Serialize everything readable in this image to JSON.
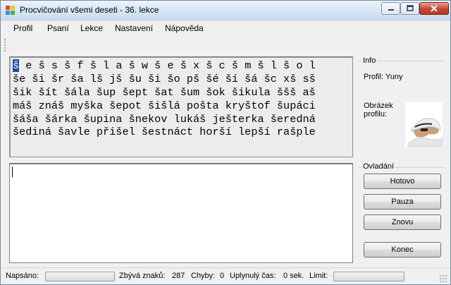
{
  "window": {
    "title": "Procvičování všemi deseti - 36. lekce"
  },
  "menu": {
    "items": [
      "Profil",
      "Psaní",
      "Lekce",
      "Nastavení",
      "Nápověda"
    ]
  },
  "practice": {
    "current_char": "š",
    "lines": [
      " e š s š f š l a š w š e š x š c š m š l š o l",
      "še ši šr ša lš jš šu ši šo pš šé ší šá šc xš sš",
      "šik šít šála šup šept šat šum šok šikula ššš aš",
      "máš znáš myška šepot šišlá pošta kryštof šupáci",
      "šáša šárka šupina šnekov lukáš ješterka šeredná",
      "šediná šavle přišel šestnáct horší lepší rašple"
    ]
  },
  "info": {
    "group_label": "Info",
    "profile_text": "Profil: Yuny",
    "avatar_label_line1": "Obrázek",
    "avatar_label_line2": "profilu:"
  },
  "controls": {
    "group_label": "Ovladání",
    "done": "Hotovo",
    "pause": "Pauza",
    "again": "Znovu",
    "end": "Konec"
  },
  "status": {
    "typed_label": "Napsáno:",
    "typed_progress": 0,
    "remaining_label": "Zbývá znaků:",
    "remaining_value": "287",
    "errors_label": "Chyby:",
    "errors_value": "0",
    "elapsed_label": "Uplynulý čas:",
    "elapsed_value": "0 sek.",
    "limit_label": "Limit:",
    "limit_progress": 0
  },
  "icons": {
    "app": "app-icon",
    "minimize": "minimize-icon",
    "maximize": "maximize-icon",
    "close": "close-icon"
  },
  "colors": {
    "highlight": "#1f4aa8",
    "close_button": "#c7432f"
  }
}
